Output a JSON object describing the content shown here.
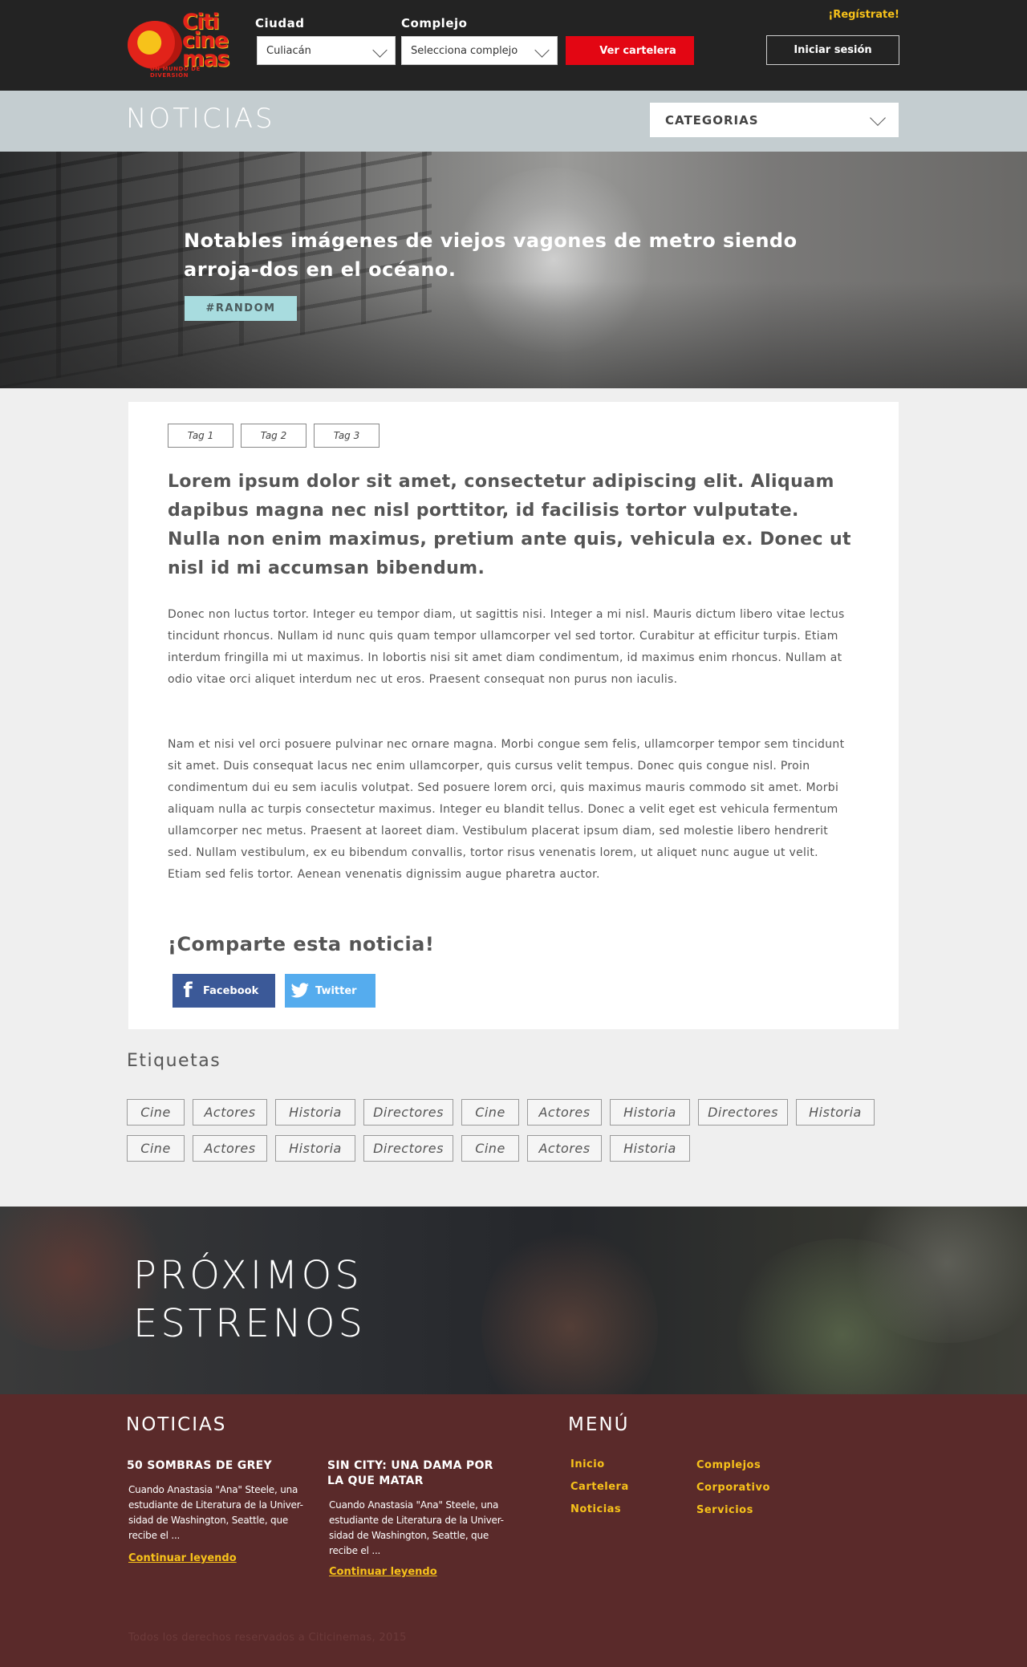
{
  "header": {
    "logo_text_line1": "Citi",
    "logo_text_line2": "cine",
    "logo_text_line3": "mas",
    "logo_tagline": "UN MUNDO DE DIVERSIÓN",
    "city_label": "Ciudad",
    "city_value": "Culiacán",
    "complex_label": "Complejo",
    "complex_value": "Selecciona complejo",
    "cartelera_button": "Ver cartelera",
    "register_link": "¡Regístrate!",
    "login_button": "Iniciar sesión"
  },
  "newsbar": {
    "title": "NOTICIAS",
    "categories_select": "CATEGORIAS"
  },
  "hero": {
    "title": "Notables imágenes de viejos vagones de metro siendo arroja-dos en el océano.",
    "tag": "#RANDOM"
  },
  "article": {
    "tags": [
      "Tag 1",
      "Tag 2",
      "Tag 3"
    ],
    "lead": "Lorem ipsum dolor sit amet, consectetur adipiscing elit. Aliquam dapibus magna nec nisl porttitor, id facilisis tortor vulputate. Nulla non enim maximus, pretium ante quis, vehicula ex. Donec ut nisl id mi accumsan bibendum.",
    "paragraph1": "Donec non luctus tortor. Integer eu tempor diam, ut sagittis nisi. Integer a mi nisl. Mauris dictum libero vitae lectus tincidunt rhoncus. Nullam id nunc quis quam tempor ullamcorper vel sed tortor. Curabitur at efficitur turpis. Etiam interdum fringilla mi ut maximus. In lobortis nisi sit amet diam condimentum, id maximus enim rhoncus. Nullam at odio vitae orci aliquet interdum nec ut eros. Praesent consequat non purus non iaculis.",
    "paragraph2": "Nam et nisi vel orci posuere pulvinar nec ornare magna. Morbi congue sem felis, ullamcorper tempor sem tincidunt sit amet. Duis consequat lacus nec enim ullamcorper, quis cursus velit tempus. Donec quis congue nisl. Proin condimentum dui eu sem iaculis volutpat. Sed posuere lorem orci, quis maximus mauris commodo sit amet. Morbi aliquam nulla ac turpis consectetur maximus. Integer eu blandit tellus. Donec a velit eget est vehicula fermentum ullamcorper nec metus. Praesent at laoreet diam. Vestibulum placerat ipsum diam, sed molestie libero hendrerit sed. Nullam vestibulum, ex eu bibendum convallis, tortor risus venenatis lorem, ut aliquet nunc augue ut velit. Etiam sed felis tortor. Aenean venenatis dignissim augue pharetra auctor.",
    "share_title": "¡Comparte esta noticia!",
    "facebook_label": "Facebook",
    "twitter_label": "Twitter"
  },
  "etiquetas": {
    "title": "Etiquetas",
    "items": [
      "Cine",
      "Actores",
      "Historia",
      "Directores",
      "Cine",
      "Actores",
      "Historia",
      "Directores",
      "Historia",
      "Cine",
      "Actores",
      "Historia",
      "Directores",
      "Cine",
      "Actores",
      "Historia"
    ]
  },
  "proximos": {
    "line1": "PRÓXIMOS",
    "line2": "ESTRENOS"
  },
  "footer": {
    "news_title": "NOTICIAS",
    "news": [
      {
        "title": "50 SOMBRAS DE GREY",
        "desc": "Cuando Anastasia \"Ana\" Steele, una estudiante de Literatura de la Univer-sidad de Washington, Seattle, que recibe el ...",
        "link": "Continuar leyendo"
      },
      {
        "title": "SIN CITY: UNA DAMA POR LA QUE MATAR",
        "desc": "Cuando Anastasia \"Ana\" Steele, una estudiante de Literatura de la Univer-sidad de Washington, Seattle, que recibe el ...",
        "link": "Continuar leyendo"
      }
    ],
    "menu_title": "MENÚ",
    "menu": [
      "Inicio",
      "Cartelera",
      "Noticias",
      "Complejos",
      "Corporativo",
      "Servicios"
    ],
    "copyright": "Todos los derechos reservados a Citicinemas, 2015"
  },
  "colors": {
    "accent_red": "#e30613",
    "accent_yellow": "#f7c21a",
    "footer_bg": "#5a2a2a",
    "facebook": "#3b5998",
    "twitter": "#55acee",
    "tag_cyan": "#a8dcdf"
  }
}
